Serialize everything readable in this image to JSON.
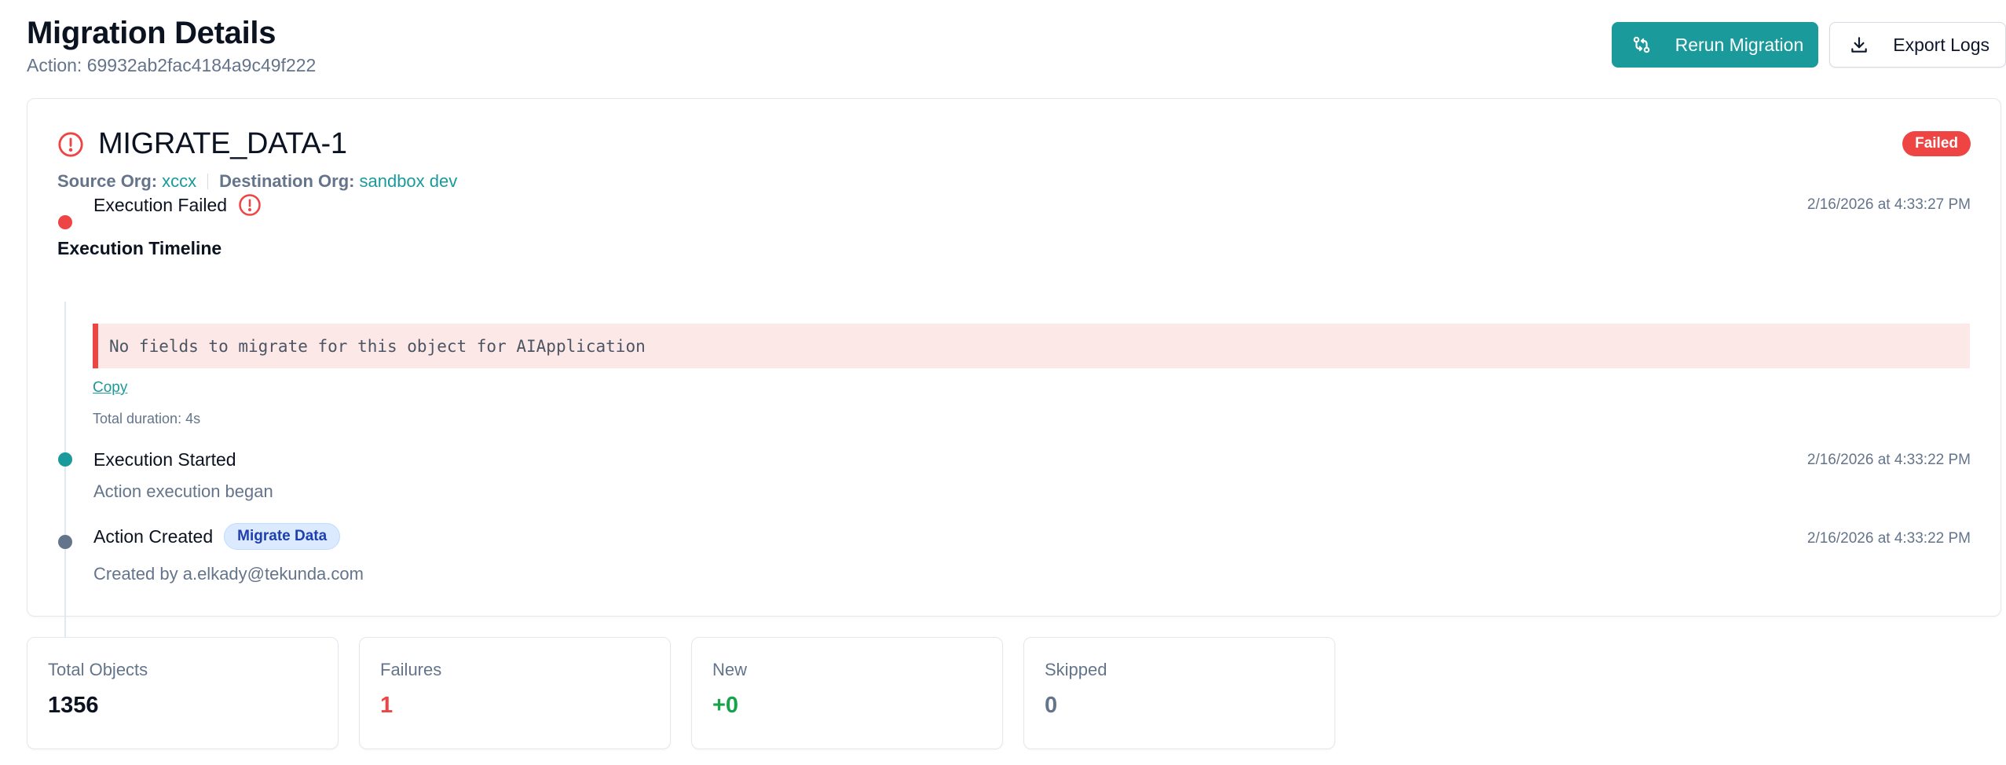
{
  "header": {
    "title": "Migration Details",
    "action_label": "Action: 69932ab2fac4184a9c49f222",
    "rerun_label": "Rerun Migration",
    "export_label": "Export Logs"
  },
  "card": {
    "title": "MIGRATE_DATA-1",
    "status": "Failed",
    "source_org_label": "Source Org:",
    "source_org_value": "xccx",
    "dest_org_label": "Destination Org:",
    "dest_org_value": "sandbox dev",
    "timeline_heading": "Execution Timeline"
  },
  "timeline": [
    {
      "title": "Execution Failed",
      "time": "2/16/2026 at 4:33:27 PM",
      "error_message": "No fields to migrate for this object for AIApplication",
      "copy_label": "Copy",
      "duration": "Total duration: 4s",
      "dot_color": "#ef4444"
    },
    {
      "title": "Execution Started",
      "time": "2/16/2026 at 4:33:22 PM",
      "description": "Action execution began",
      "dot_color": "#1a9a9a"
    },
    {
      "title": "Action Created",
      "tag": "Migrate Data",
      "time": "2/16/2026 at 4:33:22 PM",
      "description": "Created by a.elkady@tekunda.com",
      "dot_color": "#64748b"
    }
  ],
  "stats": [
    {
      "label": "Total Objects",
      "value": "1356",
      "color": "#0b1220"
    },
    {
      "label": "Failures",
      "value": "1",
      "color": "#ef4444"
    },
    {
      "label": "New",
      "value": "+0",
      "color": "#16a34a"
    },
    {
      "label": "Skipped",
      "value": "0",
      "color": "#64748b"
    }
  ],
  "colors": {
    "accent": "#1a9a9a",
    "danger": "#ef4444",
    "muted": "#64748b"
  },
  "icons": {
    "rerun": "git-compare-icon",
    "export": "download-icon",
    "alert": "alert-circle-icon"
  }
}
